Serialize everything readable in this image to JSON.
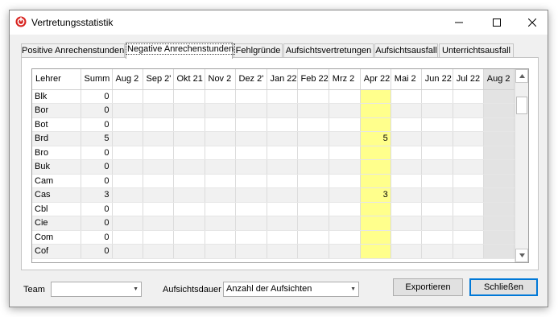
{
  "window": {
    "title": "Vertretungsstatistik"
  },
  "tabs": [
    {
      "label": "Positive Anrechenstunden",
      "active": false
    },
    {
      "label": "Negative Anrechenstunden",
      "active": true
    },
    {
      "label": "Fehlgründe",
      "active": false
    },
    {
      "label": "Aufsichtsvertretungen",
      "active": false
    },
    {
      "label": "Aufsichtsausfall",
      "active": false
    },
    {
      "label": "Unterrichtsausfall",
      "active": false
    }
  ],
  "grid": {
    "columns": [
      "Lehrer",
      "Summ",
      "Aug 2",
      "Sep 2'",
      "Okt 21",
      "Nov 2",
      "Dez 2'",
      "Jan 22",
      "Feb 22",
      "Mrz 2",
      "Apr 22",
      "Mai 2",
      "Jun 22",
      "Jul 22",
      "Aug 2"
    ],
    "highlight_column": "Apr 22",
    "highlight_color": "#ffff8c",
    "gray_column": "Aug 2",
    "rows": [
      {
        "name": "Blk",
        "sum": "0",
        "apr": ""
      },
      {
        "name": "Bor",
        "sum": "0",
        "apr": ""
      },
      {
        "name": "Bot",
        "sum": "0",
        "apr": ""
      },
      {
        "name": "Brd",
        "sum": "5",
        "apr": "5"
      },
      {
        "name": "Bro",
        "sum": "0",
        "apr": ""
      },
      {
        "name": "Buk",
        "sum": "0",
        "apr": ""
      },
      {
        "name": "Cam",
        "sum": "0",
        "apr": ""
      },
      {
        "name": "Cas",
        "sum": "3",
        "apr": "3"
      },
      {
        "name": "Cbl",
        "sum": "0",
        "apr": ""
      },
      {
        "name": "Cie",
        "sum": "0",
        "apr": ""
      },
      {
        "name": "Com",
        "sum": "0",
        "apr": ""
      },
      {
        "name": "Cof",
        "sum": "0",
        "apr": ""
      }
    ]
  },
  "footer": {
    "team_label": "Team",
    "team_value": "",
    "aufsicht_label": "Aufsichtsdauer",
    "aufsicht_value": "Anzahl der Aufsichten",
    "export_label": "Exportieren",
    "close_label": "Schließen"
  }
}
